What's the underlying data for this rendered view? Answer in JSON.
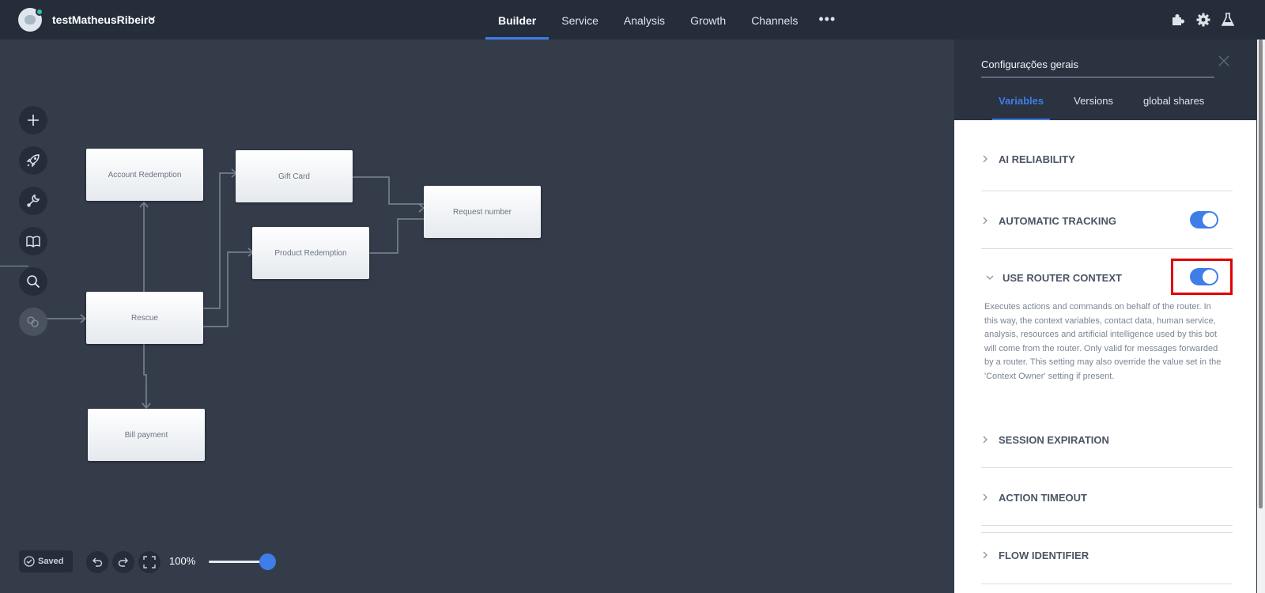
{
  "header": {
    "bot_name": "testMatheusRibeiro",
    "nav": [
      "Builder",
      "Service",
      "Analysis",
      "Growth",
      "Channels"
    ],
    "active_nav": "Builder",
    "more": "•••"
  },
  "icons": {
    "top_right": [
      "puzzle-icon",
      "gear-icon",
      "flask-icon"
    ],
    "tools": [
      "plus-icon",
      "rocket-icon",
      "wrench-icon",
      "book-icon",
      "search-icon",
      "router-icon"
    ]
  },
  "flow": {
    "nodes": {
      "account_redemption": "Account Redemption",
      "gift_card": "Gift Card",
      "request_number": "Request number",
      "product_redemption": "Product Redemption",
      "rescue": "Rescue",
      "bill_payment": "Bill payment"
    }
  },
  "bottom": {
    "saved": "Saved",
    "zoom": "100%",
    "zoom_slider_fraction": 1.0
  },
  "panel": {
    "title": "Configurações gerais",
    "tabs": [
      "Variables",
      "Versions",
      "global shares"
    ],
    "active_tab": "Variables",
    "sections": {
      "ai_reliability": "AI RELIABILITY",
      "automatic_tracking": "AUTOMATIC TRACKING",
      "use_router_context": "USE ROUTER CONTEXT",
      "router_description": "Executes actions and commands on behalf of the router. In this way, the context variables, contact data, human service, analysis, resources and artificial intelligence used by this bot will come from the router. Only valid for messages forwarded by a router. This setting may also override the value set in the 'Context Owner' setting if present.",
      "session_expiration": "SESSION EXPIRATION",
      "action_timeout": "ACTION TIMEOUT",
      "flow_identifier": "FLOW IDENTIFIER"
    },
    "toggles": {
      "automatic_tracking": true,
      "use_router_context": true
    }
  },
  "colors": {
    "accent": "#3f7de8",
    "highlight": "#e00000",
    "canvas": "#343c4a",
    "topbar": "#252d3b"
  }
}
